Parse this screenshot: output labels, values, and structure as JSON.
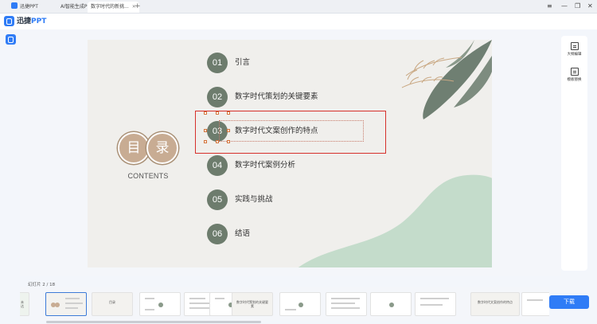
{
  "titlebar": {
    "tabs": [
      {
        "label": "迅捷PPT"
      },
      {
        "label": "AI智能生成PPT"
      },
      {
        "label": "数字时代的新挑..."
      }
    ],
    "new_tab": "+",
    "window_controls": {
      "menu": "≡",
      "minimize": "—",
      "restore": "❐",
      "close": "✕"
    }
  },
  "app": {
    "logo_text": "迅捷",
    "logo_ppt": "PPT",
    "accent_color": "#2f7cf6"
  },
  "slide": {
    "char_mu": "目",
    "char_lu": "录",
    "contents_label": "CONTENTS",
    "toc": [
      {
        "num": "01",
        "text": "引言"
      },
      {
        "num": "02",
        "text": "数字时代策划的关键要素"
      },
      {
        "num": "03",
        "text": "数字时代文案创作的特点"
      },
      {
        "num": "04",
        "text": "数字时代案例分析"
      },
      {
        "num": "05",
        "text": "实践与挑战"
      },
      {
        "num": "06",
        "text": "结语"
      }
    ],
    "colors": {
      "number_circle": "#6d7c6d",
      "title_circle": "#c8ac93",
      "blob": "#c4dccb",
      "highlight_border": "#d6302b"
    }
  },
  "rightpanel": {
    "outline_edit": "大纲编辑",
    "template_replace": "模板替换"
  },
  "filmstrip": {
    "slide_counter": "幻灯片 2 / 18",
    "thumb_captions": {
      "t1": "未达",
      "t3": "目录",
      "t7": "数字时代策划的关键要素",
      "t12": "数字时代文案创作的特点"
    }
  },
  "download_label": "下载"
}
